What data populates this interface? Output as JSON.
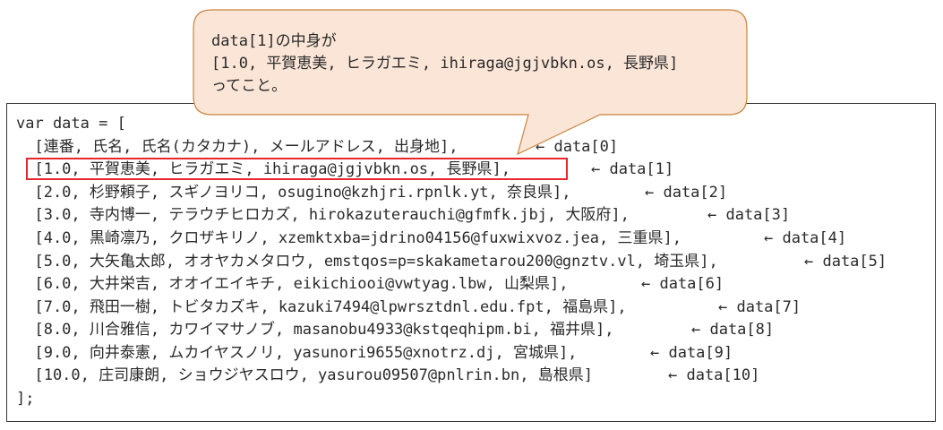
{
  "code": {
    "open": "var data = [",
    "close": "];",
    "rows": [
      {
        "text": "  [連番, 氏名, 氏名(カタカナ), メールアドレス, 出身地],",
        "ref": "← data[0]"
      },
      {
        "text": "  [1.0, 平賀恵美, ヒラガエミ, ihiraga@jgjvbkn.os, 長野県],",
        "ref": "← data[1]"
      },
      {
        "text": "  [2.0, 杉野頼子, スギノヨリコ, osugino@kzhjri.rpnlk.yt, 奈良県],",
        "ref": "← data[2]"
      },
      {
        "text": "  [3.0, 寺内博一, テラウチヒロカズ, hirokazuterauchi@gfmfk.jbj, 大阪府],",
        "ref": "← data[3]"
      },
      {
        "text": "  [4.0, 黒崎凛乃, クロザキリノ, xzemktxba=jdrino04156@fuxwixvoz.jea, 三重県],",
        "ref": "← data[4]"
      },
      {
        "text": "  [5.0, 大矢亀太郎, オオヤカメタロウ, emstqos=p=skakametarou200@gnztv.vl, 埼玉県],",
        "ref": "← data[5]"
      },
      {
        "text": "  [6.0, 大井栄吉, オオイエイキチ, eikichiooi@vwtyag.lbw, 山梨県],",
        "ref": "← data[6]"
      },
      {
        "text": "  [7.0, 飛田一樹, トビタカズキ, kazuki7494@lpwrsztdnl.edu.fpt, 福島県],",
        "ref": "← data[7]"
      },
      {
        "text": "  [8.0, 川合雅信, カワイマサノブ, masanobu4933@kstqeqhipm.bi, 福井県],",
        "ref": "← data[8]"
      },
      {
        "text": "  [9.0, 向井泰憲, ムカイヤスノリ, yasunori9655@xnotrz.dj, 宮城県],",
        "ref": "← data[9]"
      },
      {
        "text": "  [10.0, 庄司康朗, ショウジヤスロウ, yasurou09507@pnlrin.bn, 島根県]",
        "ref": "← data[10]"
      }
    ]
  },
  "callout": {
    "line1": "data[1]の中身が",
    "line2": "[1.0, 平賀恵美, ヒラガエミ, ihiraga@jgjvbkn.os, 長野県]",
    "line3": "ってこと。"
  },
  "colors": {
    "callout_fill": "#fbe5d6",
    "callout_stroke": "#c8843c",
    "highlight": "#e8262d",
    "text": "#2a2a2a"
  }
}
